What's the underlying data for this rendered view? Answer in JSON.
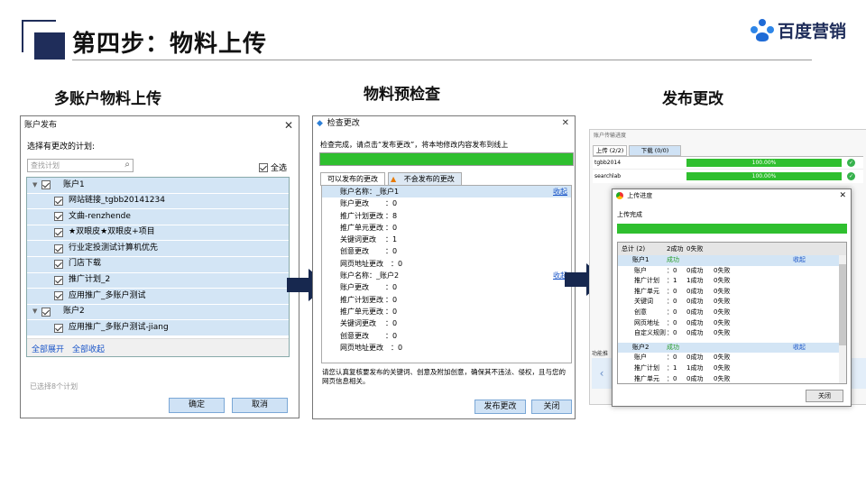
{
  "slide": {
    "title": "第四步：物料上传",
    "logo_text": "百度营销",
    "sections": [
      "多账户物料上传",
      "物料预检查",
      "发布更改"
    ]
  },
  "dialog1": {
    "title": "账户发布",
    "prompt": "选择有更改的计划:",
    "search_placeholder": "查找计划",
    "select_all": "全选",
    "groups": [
      {
        "label": "账户1",
        "items": [
          "网站链接_tgbb20141234",
          "文曲-renzhende",
          "★双眼皮★双眼皮+项目",
          "行业定投测试计算机优先",
          "门店下载",
          "推广计划_2",
          "应用推广_多账户测试"
        ]
      },
      {
        "label": "账户2",
        "items": [
          "应用推广_多账户测试-jiang"
        ]
      }
    ],
    "expand_all": "全部展开",
    "collapse_all": "全部收起",
    "selected_count": "已选择8个计划",
    "ok": "确定",
    "cancel": "取消"
  },
  "dialog2": {
    "title": "检查更改",
    "message": "检查完成，请点击“发布更改”，将本地修改内容发布到线上",
    "progress": 1.0,
    "tab_ok": "可以发布的更改",
    "tab_bad": "不会发布的更改",
    "collapse": "收起",
    "accounts": [
      {
        "name_label": "账户名称：_账户1",
        "rows": [
          [
            "账户更改",
            "：",
            "0"
          ],
          [
            "推广计划更改",
            "：",
            "8"
          ],
          [
            "推广单元更改",
            "：",
            "0"
          ],
          [
            "关键词更改",
            "：",
            "1"
          ],
          [
            "创意更改",
            "：",
            "0"
          ],
          [
            "网页地址更改",
            "：",
            "0"
          ]
        ]
      },
      {
        "name_label": "账户名称：_账户2",
        "rows": [
          [
            "账户更改",
            "：",
            "0"
          ],
          [
            "推广计划更改",
            "：",
            "0"
          ],
          [
            "推广单元更改",
            "：",
            "0"
          ],
          [
            "关键词更改",
            "：",
            "0"
          ],
          [
            "创意更改",
            "：",
            "0"
          ],
          [
            "网页地址更改",
            "：",
            "0"
          ]
        ]
      }
    ],
    "notice": "请您认真复核要发布的关键词、创意及附加创意，确保其不违法、侵权，且与您的网页信息相关。",
    "publish": "发布更改",
    "close": "关闭"
  },
  "dialog3_back": {
    "title": "账户传输进度",
    "tab_upload": "上传 (2/2)",
    "tab_download": "下载 (0/0)",
    "rows": [
      {
        "name": "tgbb2014",
        "pct": "100.00%",
        "fill": 1.0
      },
      {
        "name": "searchlab",
        "pct": "100.00%",
        "fill": 1.0
      }
    ],
    "side_label": "功能推"
  },
  "dialog3": {
    "title": "上传进度",
    "status": "上传完成",
    "progress": 1.0,
    "header": [
      "总计 (2)",
      "2成功",
      "0失败"
    ],
    "collapse": "收起",
    "accounts": [
      {
        "name": "账户1",
        "status": "成功",
        "rows": [
          [
            "账户",
            "：0",
            "0成功",
            "0失败"
          ],
          [
            "推广计划",
            "：1",
            "1成功",
            "0失败"
          ],
          [
            "推广单元",
            "：0",
            "0成功",
            "0失败"
          ],
          [
            "关键词",
            "：0",
            "0成功",
            "0失败"
          ],
          [
            "创意",
            "：0",
            "0成功",
            "0失败"
          ],
          [
            "网页地址",
            "：0",
            "0成功",
            "0失败"
          ],
          [
            "自定义规则",
            "：0",
            "0成功",
            "0失败"
          ]
        ]
      },
      {
        "name": "账户2",
        "status": "成功",
        "rows": [
          [
            "账户",
            "：0",
            "0成功",
            "0失败"
          ],
          [
            "推广计划",
            "：1",
            "1成功",
            "0失败"
          ],
          [
            "推广单元",
            "：0",
            "0成功",
            "0失败"
          ]
        ]
      }
    ],
    "close": "关闭"
  },
  "colors": {
    "navy": "#1f2d5a",
    "progress_green": "#2fbf2f",
    "selected_row": "#d3e5f5",
    "link_blue": "#1a55c8"
  }
}
